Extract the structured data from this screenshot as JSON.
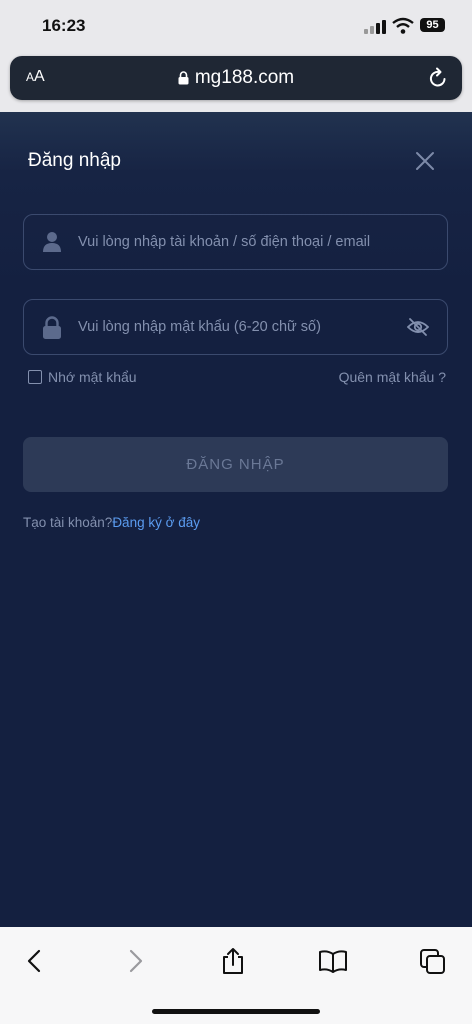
{
  "status_bar": {
    "time": "16:23",
    "battery": "95"
  },
  "browser": {
    "text_size_label_small": "A",
    "text_size_label_large": "A",
    "url": "mg188.com"
  },
  "login": {
    "title": "Đăng nhập",
    "username_placeholder": "Vui lòng nhập tài khoản / số điện thoại / email",
    "password_placeholder": "Vui lòng nhập mật khẩu (6-20 chữ số)",
    "remember_label": "Nhớ mật khẩu",
    "forgot_label": "Quên mật khẩu ?",
    "submit_label": "ĐĂNG NHẬP",
    "signup_prompt": "Tạo tài khoản?",
    "signup_link": "Đăng ký ở đây"
  },
  "colors": {
    "page_bg": "#142040",
    "link": "#5b9cf0",
    "button_bg": "#2d3a57"
  },
  "icons": [
    "signal-icon",
    "wifi-icon",
    "battery-icon",
    "lock-icon",
    "reload-icon",
    "close-icon",
    "user-icon",
    "padlock-icon",
    "eye-off-icon",
    "back-icon",
    "forward-icon",
    "share-icon",
    "bookmarks-icon",
    "tabs-icon"
  ]
}
